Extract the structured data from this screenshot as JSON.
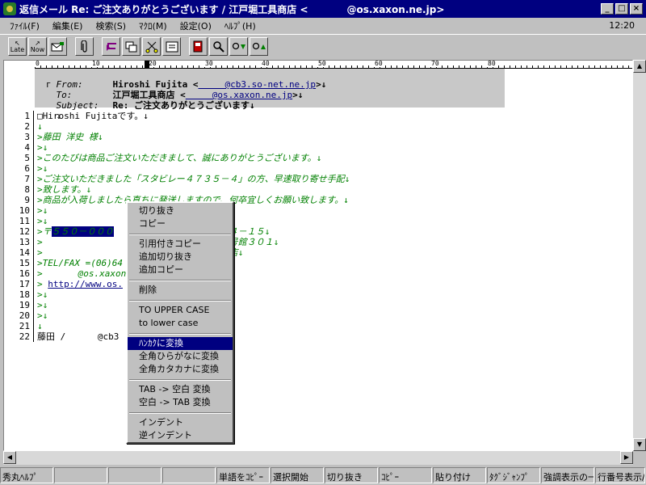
{
  "window": {
    "title": "返信メール Re: ご注文ありがとうございます / 江戸堀工具商店 <　　　　@os.xaxon.ne.jp>",
    "min": "_",
    "max": "□",
    "close": "×"
  },
  "menu": {
    "items": [
      "ﾌｧｲﾙ(F)",
      "編集(E)",
      "検索(S)",
      "ﾏｸﾛ(M)",
      "設定(O)",
      "ﾍﾙﾌﾟ(H)"
    ],
    "clock": "12:20"
  },
  "toolbar": {
    "late": "Late",
    "now": "Now"
  },
  "ruler": {
    "ticks": [
      "0",
      "10",
      "20",
      "30",
      "40",
      "50",
      "60",
      "70",
      "80"
    ]
  },
  "header": {
    "from_key": "From:",
    "from_name": "Hiroshi Fujita <",
    "from_addr": "　　　@cb3.so-net.ne.jp",
    "from_tail": ">↓",
    "to_key": "To:",
    "to_name": "江戸堀工具商店 <",
    "to_addr": "　　　@os.xaxon.ne.jp",
    "to_tail": ">↓",
    "subject_key": "Subject:",
    "subject_val": "Re: ご注文ありがとうございます↓",
    "blank": "↓",
    "corner": "г"
  },
  "lines": [
    {
      "n": "1",
      "t": "□Hiroshi Fujitaです。↓",
      "style": "plain"
    },
    {
      "n": "2",
      "t": "↓",
      "style": "arrow"
    },
    {
      "n": "3",
      "t": ">藤田 洋史 様↓",
      "style": "quote"
    },
    {
      "n": "4",
      "t": ">↓",
      "style": "quote"
    },
    {
      "n": "5",
      "t": ">このたびは商品ご注文いただきまして、誠にありがとうございます。↓",
      "style": "quote"
    },
    {
      "n": "6",
      "t": ">↓",
      "style": "quote"
    },
    {
      "n": "7",
      "t": ">ご注文いただきました「スタビレー４７３５－４」の方、早速取り寄せ手配↓",
      "style": "quote"
    },
    {
      "n": "8",
      "t": ">致します。↓",
      "style": "quote"
    },
    {
      "n": "9",
      "t": ">商品が入荷しましたら直ちに発送しますので、何卒宜しくお願い致します。↓",
      "style": "quote"
    },
    {
      "n": "10",
      "t": ">↓",
      "style": "quote"
    },
    {
      "n": "11",
      "t": ">↓",
      "style": "quote"
    },
    {
      "n": "12",
      "t": ">〒",
      "sel": "５５０－０００",
      "t2": "　　　　　　　　　堀１－２４－１５↓",
      "style": "quote"
    },
    {
      "n": "13",
      "t": ">　　　　　　　　　　　　　　　　　　ビル２号館３０１↓",
      "style": "quote"
    },
    {
      "n": "14",
      "t": ">　　　　　　　　　　　　　　　　　　工具商店↓",
      "style": "quote"
    },
    {
      "n": "15",
      "t": ">TEL/FAX =(06)64",
      "style": "quote"
    },
    {
      "n": "16",
      "t": ">　　　　@os.xaxon",
      "style": "quote"
    },
    {
      "n": "17",
      "t": "> ",
      "link": "http://www.os.",
      "t2": "　　　　　　　　　↓",
      "style": "quote"
    },
    {
      "n": "18",
      "t": ">↓",
      "style": "quote"
    },
    {
      "n": "19",
      "t": ">↓",
      "style": "quote"
    },
    {
      "n": "20",
      "t": ">↓",
      "style": "quote"
    },
    {
      "n": "21",
      "t": "↓",
      "style": "arrow"
    },
    {
      "n": "22",
      "t": "藤田 / 　　　@cb3",
      "style": "plain"
    }
  ],
  "context_menu": {
    "cut": "切り抜き",
    "copy": "コピー",
    "quote_copy": "引用付きコピー",
    "append_cut": "追加切り抜き",
    "append_copy": "追加コピー",
    "delete": "削除",
    "upper": "TO UPPER CASE",
    "lower": "to lower case",
    "hankaku": "ﾊﾝｶｸに変換",
    "zen_hira": "全角ひらがなに変換",
    "zen_kata": "全角カタカナに変換",
    "tab_space": "TAB -> 空白 変換",
    "space_tab": "空白 -> TAB 変換",
    "indent": "インデント",
    "unindent": "逆インデント"
  },
  "status": [
    "秀丸ﾍﾙﾌﾟ",
    "",
    "",
    "",
    "単語をｺﾋﾟｰ",
    "選択開始",
    "切り抜き",
    "ｺﾋﾟｰ",
    "貼り付け",
    "ﾀｸﾞｼﾞｬﾝﾌﾟ",
    "強調表示の一",
    "行番号表示/"
  ],
  "colors": {
    "title_bg": "#000080",
    "quote_text": "#008000",
    "selection": "#000080"
  }
}
